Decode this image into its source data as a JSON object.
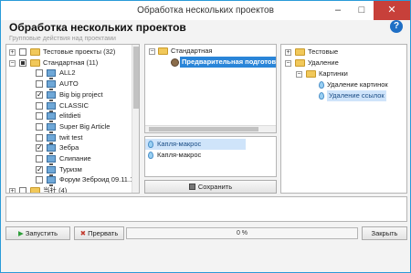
{
  "window": {
    "title": "Обработка нескольких проектов",
    "minimize_glyph": "–",
    "maximize_glyph": "□",
    "close_glyph": "✕"
  },
  "header": {
    "title": "Обработка нескольких проектов",
    "subtitle": "Групповые действия над проектами",
    "help_glyph": "?"
  },
  "left_tree": {
    "items": [
      {
        "label": "Тестовые проекты (32)",
        "type": "folder",
        "checked": "none",
        "expander": "+"
      },
      {
        "label": "Стандартная (11)",
        "type": "folder",
        "checked": "partial",
        "expander": "−"
      },
      {
        "label": "ALL2",
        "type": "project",
        "checked": "none"
      },
      {
        "label": "AUTO",
        "type": "project",
        "checked": "none"
      },
      {
        "label": "Big big project",
        "type": "project",
        "checked": "on"
      },
      {
        "label": "CLASSIC",
        "type": "project",
        "checked": "none"
      },
      {
        "label": "elitdieti",
        "type": "project",
        "checked": "none"
      },
      {
        "label": "Super Big Article",
        "type": "project",
        "checked": "none"
      },
      {
        "label": "twit test",
        "type": "project",
        "checked": "none"
      },
      {
        "label": "Зебра",
        "type": "project",
        "checked": "on"
      },
      {
        "label": "Слипание",
        "type": "project",
        "checked": "none"
      },
      {
        "label": "Туризм",
        "type": "project",
        "checked": "on"
      },
      {
        "label": "Форум Зеброид 09.11.11",
        "type": "project",
        "checked": "none"
      },
      {
        "label": "当社 (4)",
        "type": "folder",
        "checked": "none",
        "expander": "+"
      }
    ]
  },
  "middle_tree": {
    "root": "Стандартная",
    "root_expander": "−",
    "child": "Предварительная подготов"
  },
  "macro_list": {
    "items": [
      "Капля-макрос",
      "Капля-макрос"
    ]
  },
  "save_button": {
    "label": "Сохранить"
  },
  "right_tree": {
    "items": [
      {
        "label": "Тестовые",
        "expander": "+",
        "type": "folder"
      },
      {
        "label": "Удаление",
        "expander": "−",
        "type": "folder"
      },
      {
        "label": "Картинки",
        "expander": "−",
        "type": "folder"
      },
      {
        "label": "Удаление картинок",
        "type": "drop"
      },
      {
        "label": "Удаление ссылок",
        "type": "drop"
      }
    ],
    "arrow_glyph": "›"
  },
  "footer": {
    "run_label": "Запустить",
    "stop_label": "Прервать",
    "progress_text": "0 %",
    "progress_value": 0,
    "close_label": "Закрыть",
    "run_glyph": "▶",
    "stop_glyph": "✖"
  }
}
